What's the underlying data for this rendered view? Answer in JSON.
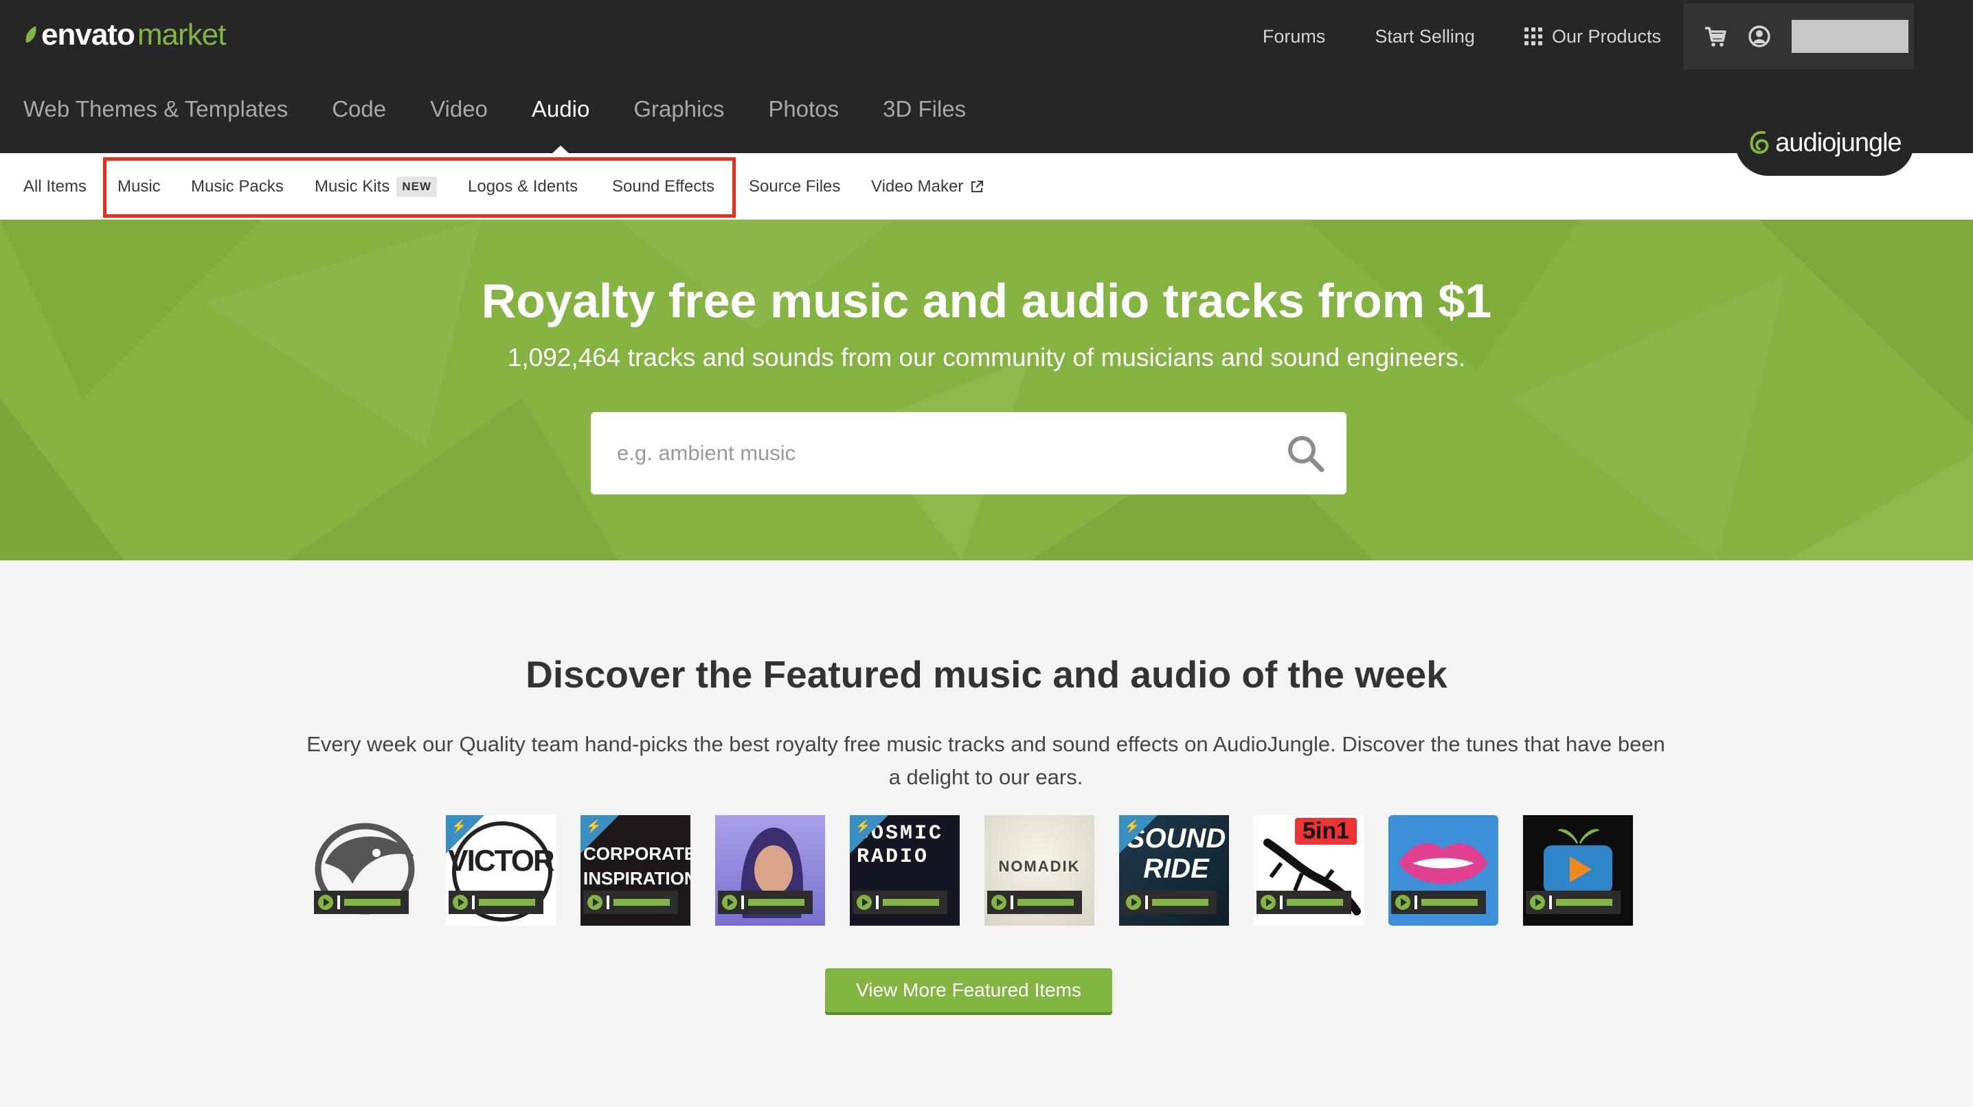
{
  "header": {
    "logo_main": "envato",
    "logo_sub": "market",
    "links": {
      "forums": "Forums",
      "start_selling": "Start Selling",
      "our_products": "Our Products"
    },
    "badge": "audiojungle"
  },
  "main_nav": [
    {
      "label": "Web Themes & Templates",
      "active": false
    },
    {
      "label": "Code",
      "active": false
    },
    {
      "label": "Video",
      "active": false
    },
    {
      "label": "Audio",
      "active": true
    },
    {
      "label": "Graphics",
      "active": false
    },
    {
      "label": "Photos",
      "active": false
    },
    {
      "label": "3D Files",
      "active": false
    }
  ],
  "sub_nav": {
    "all_items": "All Items",
    "music": "Music",
    "music_packs": "Music Packs",
    "music_kits": "Music Kits",
    "new_tag": "NEW",
    "logos_idents": "Logos & Idents",
    "sound_effects": "Sound Effects",
    "source_files": "Source Files",
    "video_maker": "Video Maker"
  },
  "hero": {
    "title": "Royalty free music and audio tracks from $1",
    "subtitle": "1,092,464 tracks and sounds from our community of musicians and sound engineers.",
    "search_placeholder": "e.g. ambient music"
  },
  "featured": {
    "title": "Discover the Featured music and audio of the week",
    "description": "Every week our Quality team hand-picks the best royalty free music tracks and sound effects on AudioJungle. Discover the tunes that have been a delight to our ears.",
    "items": [
      {
        "label": ""
      },
      {
        "label": "VICTOR"
      },
      {
        "label": "CORPORATE INSPIRATION"
      },
      {
        "label": ""
      },
      {
        "label": "COSMIC RADIO"
      },
      {
        "label": "NOMADIK"
      },
      {
        "label": "SOUND RIDE"
      },
      {
        "label": "5in1"
      },
      {
        "label": ""
      },
      {
        "label": ""
      }
    ],
    "view_more": "View More Featured Items"
  },
  "colors": {
    "header_bg": "#262626",
    "accent_green": "#82b541",
    "hero_green": "#85b341",
    "highlight_red": "#e0321c"
  }
}
